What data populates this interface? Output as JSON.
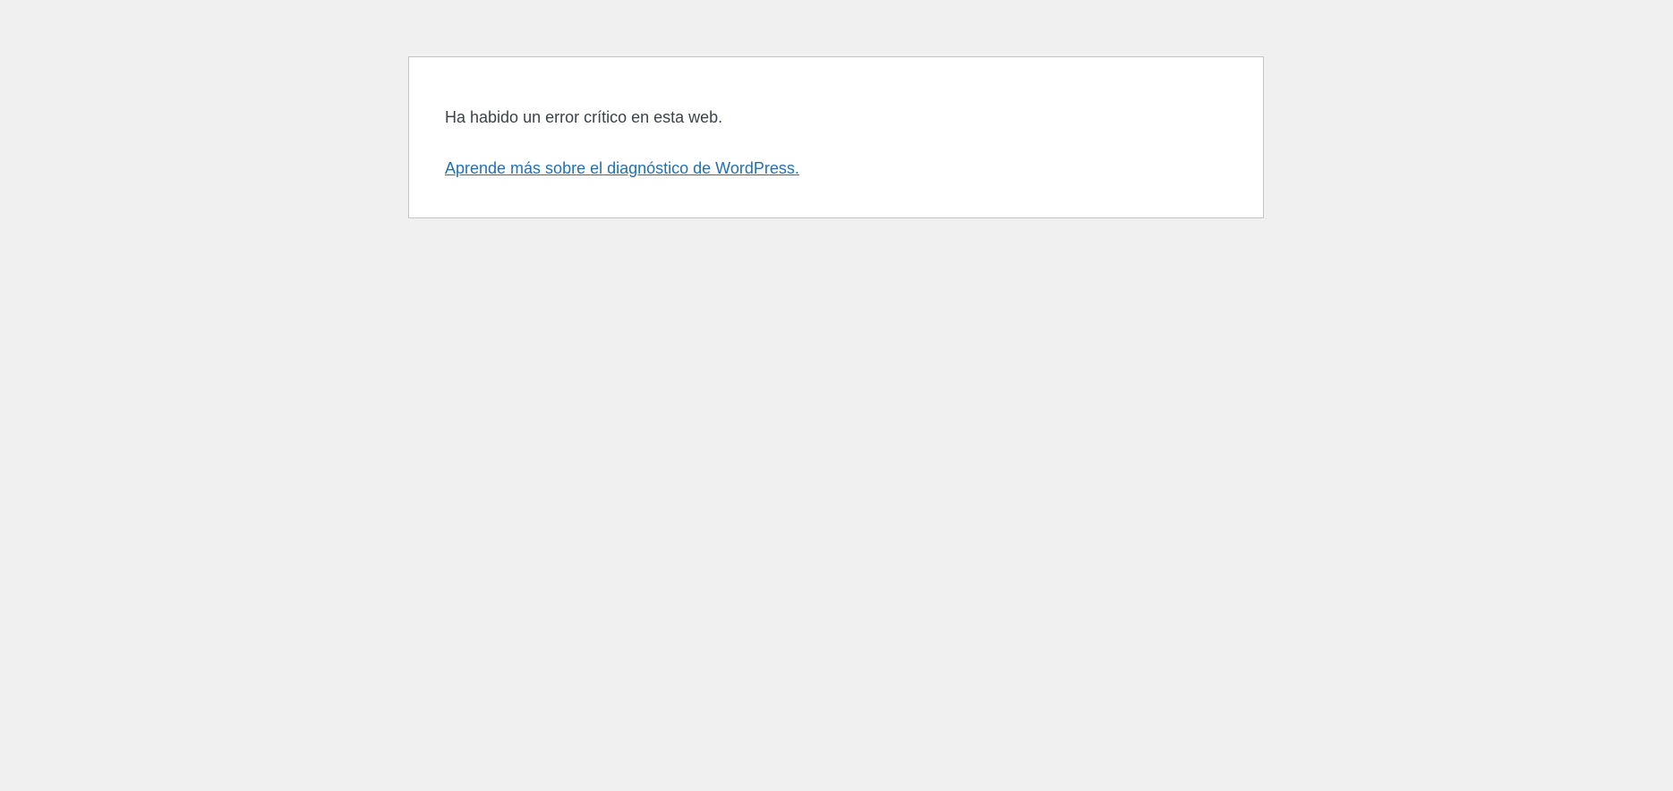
{
  "error": {
    "message": "Ha habido un error crítico en esta web.",
    "link_label": "Aprende más sobre el diagnóstico de WordPress."
  },
  "colors": {
    "background": "#f0f0f1",
    "panel": "#ffffff",
    "text": "#3c434a",
    "link": "#2271b1"
  }
}
